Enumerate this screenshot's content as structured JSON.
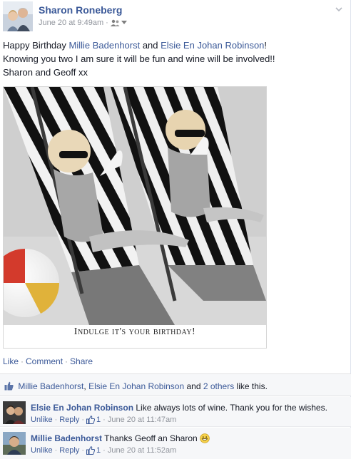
{
  "post": {
    "author": "Sharon Roneberg",
    "timestamp": "June 20 at 9:49am",
    "meta_dot": "·",
    "audience_icon": "friends-icon",
    "text": {
      "line1_prefix": "Happy Birthday ",
      "tag1": "Millie Badenhorst",
      "line1_and": " and ",
      "tag2": "Elsie En Johan Robinson",
      "line1_suffix": "!",
      "line2": "Knowing you two I am sure it will be fun and wine will be involved!!",
      "line3": "Sharon and Geoff xx"
    },
    "photo": {
      "caption": "Indulge it's your birthday!"
    },
    "actions": {
      "like": "Like",
      "comment": "Comment",
      "share": "Share",
      "sep": "·"
    }
  },
  "likes": {
    "name1": "Millie Badenhorst",
    "comma": ", ",
    "name2": "Elsie En Johan Robinson",
    "and": " and ",
    "others": "2 others",
    "suffix": " like this."
  },
  "comments": [
    {
      "author": "Elsie En Johan Robinson",
      "text": " Like always lots of wine. Thank you for the wishes.",
      "unlike": "Unlike",
      "reply": "Reply",
      "like_count": "1",
      "time": "June 20 at 11:47am",
      "sep": "·"
    },
    {
      "author": "Millie Badenhorst",
      "text": " Thanks Geoff an Sharon ",
      "unlike": "Unlike",
      "reply": "Reply",
      "like_count": "1",
      "time": "June 20 at 11:52am",
      "sep": "·",
      "emoji": "grin-emoji-icon"
    }
  ],
  "colors": {
    "link": "#3b5998",
    "meta": "#90949c",
    "ufi_bg": "#f6f7f9"
  }
}
